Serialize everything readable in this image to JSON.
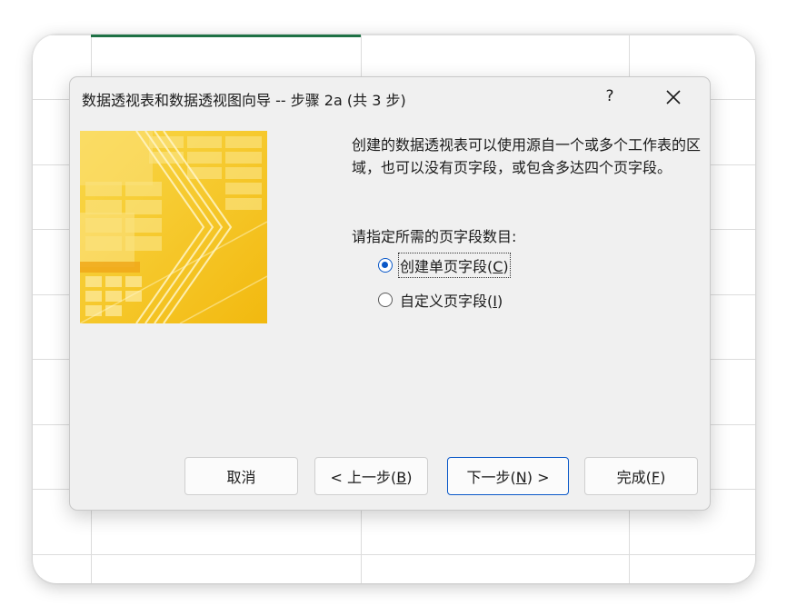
{
  "dialog": {
    "title": "数据透视表和数据透视图向导 -- 步骤 2a (共 3 步)",
    "help_label": "?",
    "close_icon": "close-icon",
    "description": "创建的数据透视表可以使用源自一个或多个工作表的区域，也可以没有页字段，或包含多达四个页字段。",
    "prompt": "请指定所需的页字段数目:",
    "options": [
      {
        "label": "创建单页字段(",
        "key": "C",
        "suffix": ")",
        "selected": true
      },
      {
        "label": "自定义页字段(",
        "key": "I",
        "suffix": ")",
        "selected": false
      }
    ],
    "buttons": {
      "cancel": "取消",
      "back_prefix": "< 上一步(",
      "back_key": "B",
      "back_suffix": ")",
      "next_prefix": "下一步(",
      "next_key": "N",
      "next_suffix": ") >",
      "finish_prefix": "完成(",
      "finish_key": "F",
      "finish_suffix": ")"
    }
  },
  "colors": {
    "accent": "#0a58c8",
    "dialog_bg": "#f0f0f0",
    "banner_yellow": "#f7c42a",
    "sheet_selection": "#1e7145"
  }
}
